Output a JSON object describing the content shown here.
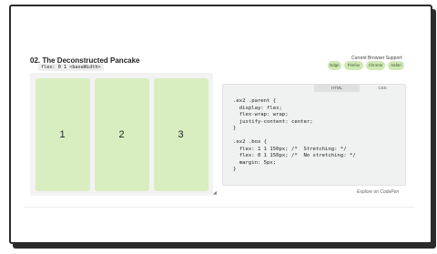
{
  "header": {
    "title": "02. The Deconstructed Pancake",
    "code_chip": "flex: 0 1 <baseWidth>"
  },
  "support": {
    "label": "Current Browser Support:",
    "browsers": [
      "Edge",
      "Firefox",
      "Chrome",
      "Safari"
    ]
  },
  "demo": {
    "boxes": [
      "1",
      "2",
      "3"
    ]
  },
  "code_panel": {
    "tabs": [
      "HTML",
      "CSS"
    ],
    "active_tab": "CSS",
    "code": ".ex2 .parent {\n  display: flex;\n  flex-wrap: wrap;\n  justify-content: center;\n}\n\n.ex2 .box {\n  flex: 1 1 150px; /*  Stretching: */\n  flex: 0 1 150px; /*  No stretching: */\n  margin: 5px;\n}"
  },
  "footer": {
    "codepen_label": "Explore on CodePen"
  },
  "colors": {
    "box_green": "#d8eec0",
    "badge_green": "#cfe8b4"
  }
}
